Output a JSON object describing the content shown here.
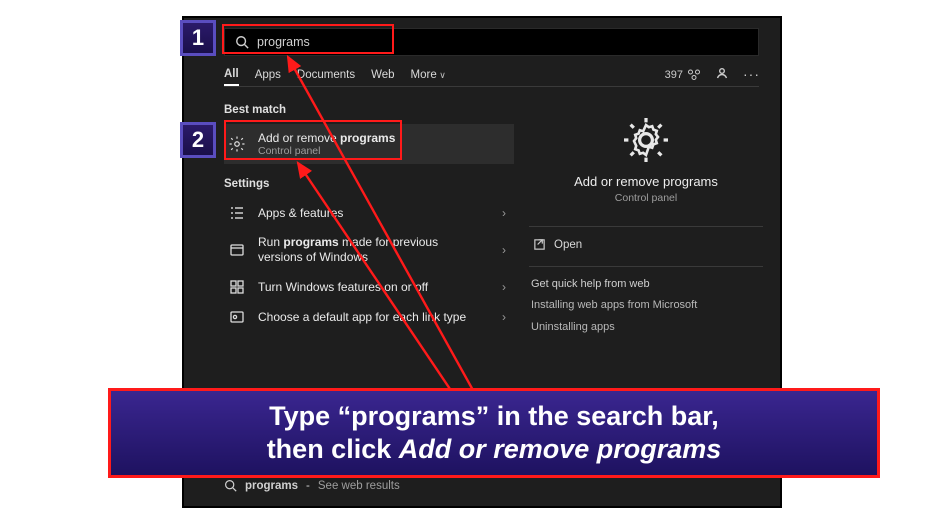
{
  "search": {
    "value": "programs"
  },
  "tabs": [
    "All",
    "Apps",
    "Documents",
    "Web",
    "More"
  ],
  "toolbar": {
    "count": "397"
  },
  "left": {
    "best_match_label": "Best match",
    "best_match": {
      "title_prefix": "Add or remove ",
      "title_bold": "programs",
      "sub": "Control panel"
    },
    "settings_label": "Settings",
    "settings_items": [
      {
        "title": "Apps & features"
      },
      {
        "title_prefix": "Run ",
        "title_bold": "programs",
        "title_suffix": " made for previous versions of Windows"
      },
      {
        "title": "Turn Windows features on or off"
      },
      {
        "title": "Choose a default app for each link type"
      }
    ]
  },
  "right": {
    "title": "Add or remove programs",
    "sub": "Control panel",
    "open": "Open",
    "help_label": "Get quick help from web",
    "links": [
      "Installing web apps from Microsoft",
      "Uninstalling apps"
    ]
  },
  "footer": {
    "bold": "programs",
    "sub": "See web results"
  },
  "annotation": {
    "step1": "1",
    "step2": "2",
    "instruction_a": "Type “programs” in the search bar,",
    "instruction_b": "then click ",
    "instruction_c": "Add or remove programs"
  }
}
